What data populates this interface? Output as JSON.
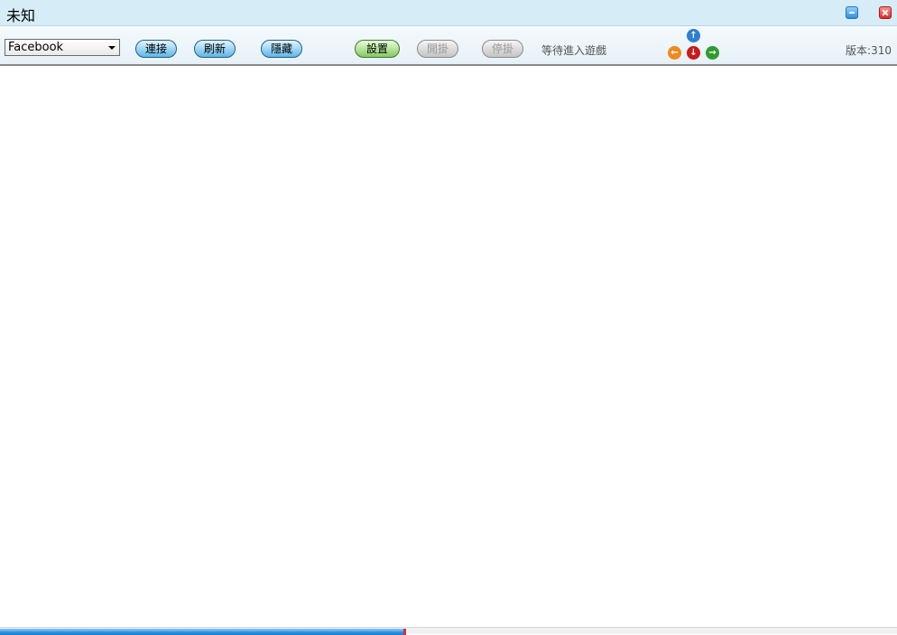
{
  "window": {
    "title": "未知",
    "minimize_icon": "minimize-icon",
    "close_icon": "close-icon"
  },
  "toolbar": {
    "platform_select": {
      "value": "Facebook"
    },
    "connect_label": "連接",
    "refresh_label": "刷新",
    "hide_label": "隱藏",
    "settings_label": "設置",
    "start_label": "開掛",
    "stop_label": "停掛",
    "status_text": "等待進入遊戲",
    "version_text": "版本:310",
    "arrows": {
      "up": "↑",
      "left": "←",
      "down": "↓",
      "right": "→"
    }
  },
  "progress": {
    "fraction": 0.45
  },
  "colors": {
    "accent_blue": "#2d7fd2",
    "arrow_left": "#f08a1e",
    "arrow_down": "#cc1a1a",
    "arrow_right": "#2f9b2f"
  }
}
